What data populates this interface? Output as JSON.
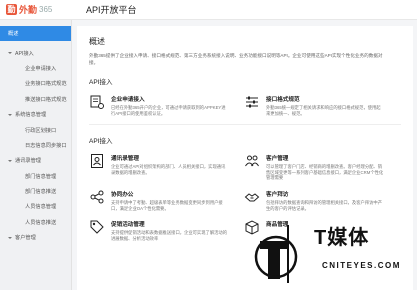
{
  "app": {
    "logo_text": "外勤",
    "logo_num": "365",
    "title": "API开放平台"
  },
  "sidebar": {
    "items": [
      {
        "label": "概述",
        "type": "top",
        "active": true
      },
      {
        "label": "API接入",
        "type": "top",
        "caret": true
      },
      {
        "label": "企业申请接入",
        "type": "sub"
      },
      {
        "label": "业务接口格式规范",
        "type": "sub"
      },
      {
        "label": "推送接口格式规范",
        "type": "sub"
      },
      {
        "label": "系统信息管理",
        "type": "top",
        "caret": true
      },
      {
        "label": "行政区划接口",
        "type": "sub"
      },
      {
        "label": "日志信息同步接口",
        "type": "sub"
      },
      {
        "label": "通讯录管理",
        "type": "top",
        "caret": true
      },
      {
        "label": "部门信息管理",
        "type": "sub"
      },
      {
        "label": "部门信息推送",
        "type": "sub"
      },
      {
        "label": "人员信息管理",
        "type": "sub"
      },
      {
        "label": "人员信息推送",
        "type": "sub"
      },
      {
        "label": "客户管理",
        "type": "top",
        "caret": true
      }
    ]
  },
  "main": {
    "title": "概述",
    "intro": "外勤365提供了企业接入申请、接口格式规范、第三方业务系统接入说明、业务功能接口说明等API。企业可使用这些API实现个性化业务的数据对接。",
    "section_api": "API接入",
    "api_cards": [
      {
        "title": "企业申请接入",
        "desc": "已经在外勤365开户的企业，可通过申请获取到的APPKEY进行API接口的使用鉴权认证。"
      },
      {
        "title": "接口格式规范",
        "desc": "外勤365统一规定了相关请求和响应的接口格式规范，使用起来更加统一、规范。"
      }
    ],
    "section_api2": "API接入",
    "api2_cards": [
      {
        "title": "通讯录管理",
        "desc": "企业可通过API对组织架构的部门、人员相关接口，实现通讯录数据的增删改查。"
      },
      {
        "title": "客户管理",
        "desc": "可以管理了客户门店、经销商的增删改查。客户经理分配、销售区域变更等一系列客户基础信息接口，满足企业CRM个性化管理需要"
      },
      {
        "title": "协同办公",
        "desc": "支持申请中了考勤、超级表单等业务数据变更同步到用户接口，满足企业OA个性化需要。"
      },
      {
        "title": "客户拜访",
        "desc": "包括拜访的数据查询和拜访的管理相关接口，及客户拜访中产生的客户的评估记录。"
      },
      {
        "title": "促销活动管理",
        "desc": "支持提供促销活动和表数据推送接口，企业可实现了解活动的进展数据、分析活动效率"
      },
      {
        "title": "商品管理",
        "desc": ""
      }
    ]
  },
  "watermark": {
    "big": "T媒体",
    "small": "CNITEYES.COM"
  }
}
